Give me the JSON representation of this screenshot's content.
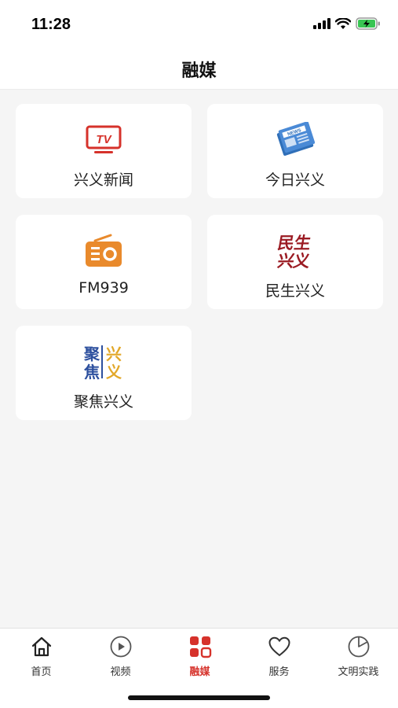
{
  "status": {
    "time": "11:28"
  },
  "header": {
    "title": "融媒"
  },
  "cards": [
    {
      "label": "兴义新闻",
      "icon": "tv-icon"
    },
    {
      "label": "今日兴义",
      "icon": "newspaper-icon"
    },
    {
      "label": "FM939",
      "icon": "radio-icon"
    },
    {
      "label": "民生兴义",
      "icon": "minsheng-logo"
    },
    {
      "label": "聚焦兴义",
      "icon": "jujiao-logo"
    }
  ],
  "tabs": [
    {
      "label": "首页",
      "icon": "home-icon",
      "active": false
    },
    {
      "label": "视频",
      "icon": "play-icon",
      "active": false
    },
    {
      "label": "融媒",
      "icon": "grid-icon",
      "active": true
    },
    {
      "label": "服务",
      "icon": "heart-icon",
      "active": false
    },
    {
      "label": "文明实践",
      "icon": "pie-icon",
      "active": false
    }
  ],
  "colors": {
    "accent": "#d6322b",
    "radio": "#e98a2c",
    "background": "#f5f5f5"
  },
  "logo_text": {
    "tv": "TV",
    "news": "NEWS",
    "minsheng": "民生兴义",
    "jujiao": "聚焦兴义"
  }
}
